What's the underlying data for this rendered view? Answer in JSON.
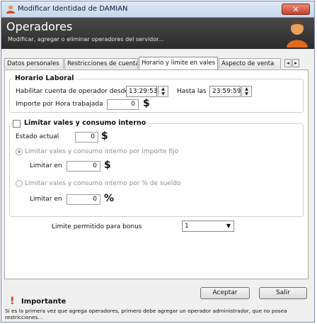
{
  "window": {
    "title": "Modificar Identidad de DAMIAN",
    "close_label": "✕"
  },
  "header": {
    "title": "Operadores",
    "subtitle": "Modificar, agregar o eliminar operadores del servidor..."
  },
  "tabs": [
    {
      "label": "Datos personales"
    },
    {
      "label": "Restricciones de cuenta"
    },
    {
      "label": "Horario y limite en vales"
    },
    {
      "label": "Aspecto de venta"
    }
  ],
  "tab_scroll": {
    "left": "◂",
    "right": "▸"
  },
  "horario": {
    "legend": "Horario Laboral",
    "desde_label": "Habilitar cuenta de operador desde",
    "desde_value": "13:29:53",
    "hasta_label": "Hasta las",
    "hasta_value": "23:59:59",
    "importe_label": "Importe por Hora trabajada",
    "importe_value": "0",
    "currency": "$"
  },
  "limites": {
    "legend": "Limitar vales y consumo interno",
    "checked": false,
    "estado_label": "Estado actual",
    "estado_value": "0",
    "estado_currency": "$",
    "opt_importe_label": "Limitar vales y consumo interno por importe fijo",
    "opt_importe_selected": true,
    "limitar_en_label_1": "Limitar en",
    "limitar_en_value_1": "0",
    "limitar_en_unit_1": "$",
    "opt_sueldo_label": "Limitar vales y consumo interno por % de sueldo",
    "opt_sueldo_selected": false,
    "limitar_en_label_2": "Limitar en",
    "limitar_en_value_2": "0",
    "limitar_en_unit_2": "%"
  },
  "bonus": {
    "label": "Limite permitido para bonus",
    "value": "1"
  },
  "footer": {
    "title": "Importante",
    "text": "Si es la primera vez que agrega operadores, primero debe agregar un operador administrador, que no posea restricciones..."
  },
  "buttons": {
    "accept": "Aceptar",
    "exit": "Salir"
  },
  "colors": {
    "header_bg": "#2b2b2b",
    "close_btn": "#c6412c",
    "warning_icon": "#e03b00"
  },
  "icons": {
    "title": "user-icon",
    "header": "avatar-person-icon",
    "warning": "exclamation-icon"
  }
}
